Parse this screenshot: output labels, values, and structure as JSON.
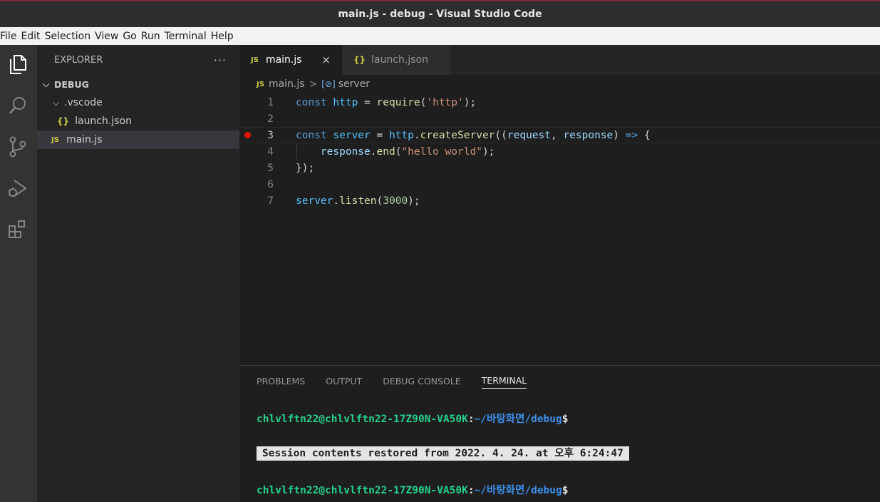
{
  "window": {
    "title": "main.js - debug - Visual Studio Code"
  },
  "menu": [
    "File",
    "Edit",
    "Selection",
    "View",
    "Go",
    "Run",
    "Terminal",
    "Help"
  ],
  "activity_bar": [
    "explorer-icon",
    "search-icon",
    "source-control-icon",
    "run-debug-icon",
    "extensions-icon"
  ],
  "sidebar": {
    "header": "EXPLORER",
    "more_actions": "···",
    "tree": [
      {
        "label": "DEBUG",
        "kind": "folder-root",
        "expanded": true
      },
      {
        "label": ".vscode",
        "kind": "folder",
        "expanded": true
      },
      {
        "label": "launch.json",
        "kind": "json-file",
        "badge": "{}"
      },
      {
        "label": "main.js",
        "kind": "js-file",
        "badge": "JS",
        "selected": true
      }
    ]
  },
  "tabs": [
    {
      "label": "main.js",
      "badge": "JS",
      "active": true,
      "close": "×"
    },
    {
      "label": "launch.json",
      "badge": "{}",
      "active": false
    }
  ],
  "breadcrumb": {
    "badge": "JS",
    "file": "main.js",
    "separator": ">",
    "symbol": "server"
  },
  "editor": {
    "line_numbers": [
      "1",
      "2",
      "3",
      "4",
      "5",
      "6",
      "7"
    ],
    "current_line": 3,
    "breakpoint_line": 3,
    "code": [
      "const http = require('http');",
      "",
      "const server = http.createServer((request, response) => {",
      "    response.end(\"hello world\");",
      "});",
      "",
      "server.listen(3000);"
    ]
  },
  "panel": {
    "tabs": [
      "PROBLEMS",
      "OUTPUT",
      "DEBUG CONSOLE",
      "TERMINAL"
    ],
    "active_tab": "TERMINAL",
    "terminal": {
      "prompt_user": "chlvlftn22@chlvlftn22-17Z90N-VA50K",
      "prompt_sep": ":",
      "prompt_path": "~/바탕화면/debug",
      "prompt_end": "$",
      "session_message": "Session contents restored from 2022. 4. 24. at 오후 6:24:47"
    }
  },
  "colors": {
    "activity_bar": "#333333",
    "sidebar": "#252526",
    "editor": "#1e1e1e",
    "terminal_user": "#23d18b",
    "terminal_path": "#3b8eea",
    "breakpoint": "#e51400"
  }
}
